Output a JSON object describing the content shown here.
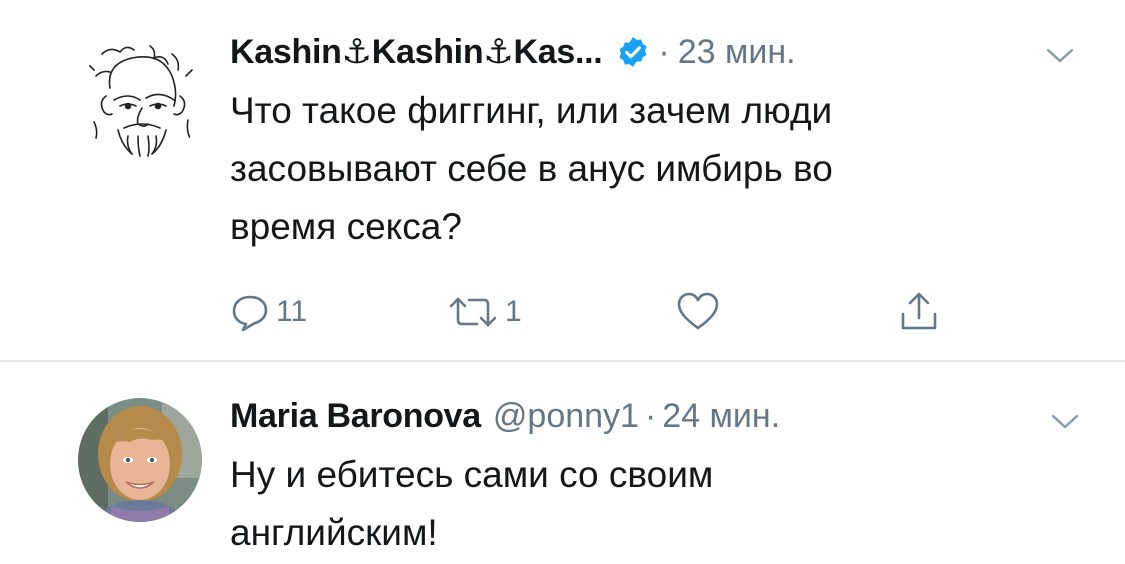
{
  "tweets": [
    {
      "display_name": "Kashin⚓Kashin⚓Kas...",
      "verified": true,
      "time": "23 мин.",
      "text": "Что такое фиггинг, или зачем люди\nзасовывают себе в анус имбирь во\nвремя секса?",
      "reply_count": "11",
      "retweet_count": "1",
      "avatar": "sketch-portrait-avatar"
    },
    {
      "display_name": "Maria Baronova",
      "handle": "@ponny1",
      "time": "24 мин.",
      "text": "Ну и ебитесь сами со своим\nанглийским!",
      "avatar": "photo-avatar"
    }
  ],
  "separator": "·",
  "colors": {
    "text": "#14171a",
    "secondary": "#657786",
    "verified": "#1da1f2",
    "divider": "#e1e8ed"
  },
  "icons": [
    "reply-icon",
    "retweet-icon",
    "like-icon",
    "share-icon",
    "chevron-down-icon",
    "verified-badge-icon"
  ]
}
